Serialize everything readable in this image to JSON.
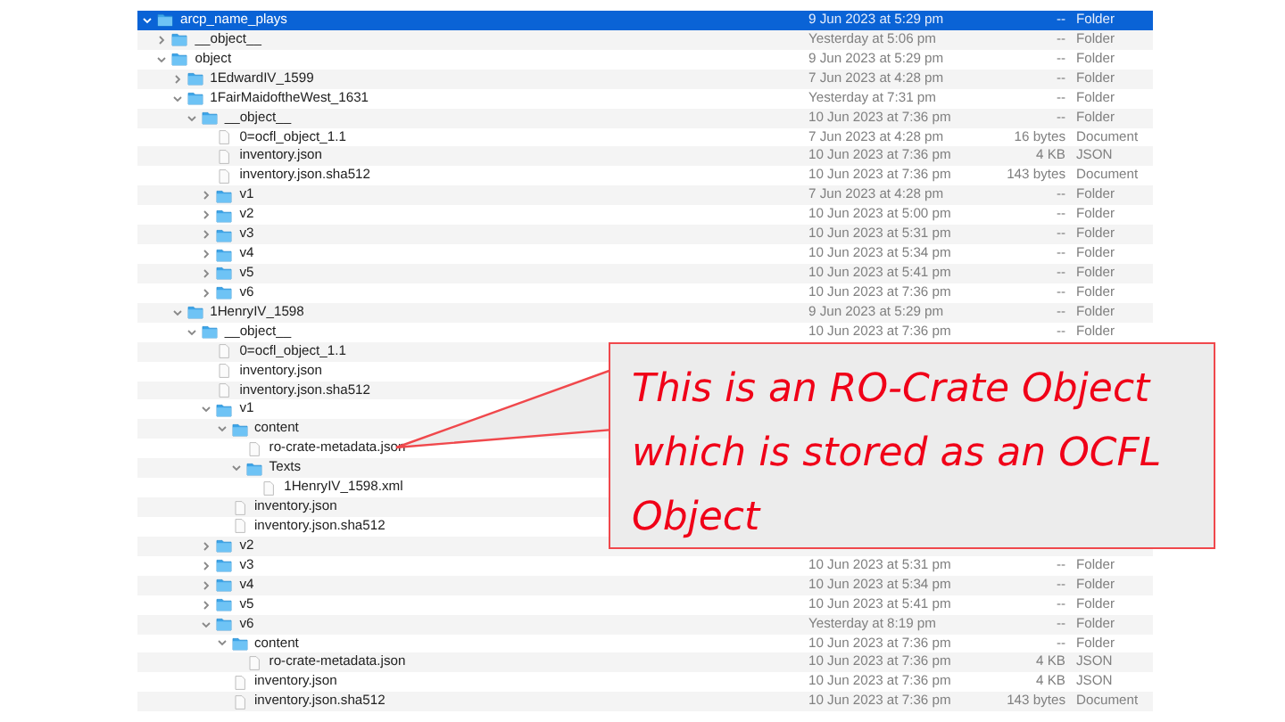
{
  "tree": [
    {
      "name": "arcp_name_plays",
      "kind": "folder",
      "expanded": true,
      "selected": true,
      "modified": "9 Jun 2023 at 5:29 pm",
      "file_size": "--",
      "file_kind": "Folder",
      "children": [
        {
          "name": "__object__",
          "kind": "folder",
          "expanded": false,
          "selected": false,
          "modified": "Yesterday at 5:06 pm",
          "file_size": "--",
          "file_kind": "Folder"
        },
        {
          "name": "object",
          "kind": "folder",
          "expanded": true,
          "selected": false,
          "modified": "9 Jun 2023 at 5:29 pm",
          "file_size": "--",
          "file_kind": "Folder",
          "children": [
            {
              "name": "1EdwardIV_1599",
              "kind": "folder",
              "expanded": false,
              "selected": false,
              "modified": "7 Jun 2023 at 4:28 pm",
              "file_size": "--",
              "file_kind": "Folder"
            },
            {
              "name": "1FairMaidoftheWest_1631",
              "kind": "folder",
              "expanded": true,
              "selected": false,
              "modified": "Yesterday at 7:31 pm",
              "file_size": "--",
              "file_kind": "Folder",
              "children": [
                {
                  "name": "__object__",
                  "kind": "folder",
                  "expanded": true,
                  "selected": false,
                  "modified": "10 Jun 2023 at 7:36 pm",
                  "file_size": "--",
                  "file_kind": "Folder",
                  "children": [
                    {
                      "name": "0=ocfl_object_1.1",
                      "kind": "file",
                      "selected": false,
                      "modified": "7 Jun 2023 at 4:28 pm",
                      "file_size": "16 bytes",
                      "file_kind": "Document"
                    },
                    {
                      "name": "inventory.json",
                      "kind": "file",
                      "selected": false,
                      "modified": "10 Jun 2023 at 7:36 pm",
                      "file_size": "4 KB",
                      "file_kind": "JSON"
                    },
                    {
                      "name": "inventory.json.sha512",
                      "kind": "file",
                      "selected": false,
                      "modified": "10 Jun 2023 at 7:36 pm",
                      "file_size": "143 bytes",
                      "file_kind": "Document"
                    },
                    {
                      "name": "v1",
                      "kind": "folder",
                      "expanded": false,
                      "selected": false,
                      "modified": "7 Jun 2023 at 4:28 pm",
                      "file_size": "--",
                      "file_kind": "Folder"
                    },
                    {
                      "name": "v2",
                      "kind": "folder",
                      "expanded": false,
                      "selected": false,
                      "modified": "10 Jun 2023 at 5:00 pm",
                      "file_size": "--",
                      "file_kind": "Folder"
                    },
                    {
                      "name": "v3",
                      "kind": "folder",
                      "expanded": false,
                      "selected": false,
                      "modified": "10 Jun 2023 at 5:31 pm",
                      "file_size": "--",
                      "file_kind": "Folder"
                    },
                    {
                      "name": "v4",
                      "kind": "folder",
                      "expanded": false,
                      "selected": false,
                      "modified": "10 Jun 2023 at 5:34 pm",
                      "file_size": "--",
                      "file_kind": "Folder"
                    },
                    {
                      "name": "v5",
                      "kind": "folder",
                      "expanded": false,
                      "selected": false,
                      "modified": "10 Jun 2023 at 5:41 pm",
                      "file_size": "--",
                      "file_kind": "Folder"
                    },
                    {
                      "name": "v6",
                      "kind": "folder",
                      "expanded": false,
                      "selected": false,
                      "modified": "10 Jun 2023 at 7:36 pm",
                      "file_size": "--",
                      "file_kind": "Folder"
                    }
                  ]
                }
              ]
            },
            {
              "name": "1HenryIV_1598",
              "kind": "folder",
              "expanded": true,
              "selected": false,
              "modified": "9 Jun 2023 at 5:29 pm",
              "file_size": "--",
              "file_kind": "Folder",
              "children": [
                {
                  "name": "__object__",
                  "kind": "folder",
                  "expanded": true,
                  "selected": false,
                  "modified": "10 Jun 2023 at 7:36 pm",
                  "file_size": "--",
                  "file_kind": "Folder",
                  "children": [
                    {
                      "name": "0=ocfl_object_1.1",
                      "kind": "file",
                      "selected": false
                    },
                    {
                      "name": "inventory.json",
                      "kind": "file",
                      "selected": false
                    },
                    {
                      "name": "inventory.json.sha512",
                      "kind": "file",
                      "selected": false
                    },
                    {
                      "name": "v1",
                      "kind": "folder",
                      "expanded": true,
                      "selected": false,
                      "children": [
                        {
                          "name": "content",
                          "kind": "folder",
                          "expanded": true,
                          "selected": false,
                          "children": [
                            {
                              "name": "ro-crate-metadata.json",
                              "kind": "file",
                              "selected": false
                            },
                            {
                              "name": "Texts",
                              "kind": "folder",
                              "expanded": true,
                              "selected": false,
                              "children": [
                                {
                                  "name": "1HenryIV_1598.xml",
                                  "kind": "file",
                                  "selected": false
                                }
                              ]
                            }
                          ]
                        },
                        {
                          "name": "inventory.json",
                          "kind": "file",
                          "selected": false
                        },
                        {
                          "name": "inventory.json.sha512",
                          "kind": "file",
                          "selected": false
                        }
                      ]
                    },
                    {
                      "name": "v2",
                      "kind": "folder",
                      "expanded": false,
                      "selected": false
                    },
                    {
                      "name": "v3",
                      "kind": "folder",
                      "expanded": false,
                      "selected": false,
                      "modified": "10 Jun 2023 at 5:31 pm",
                      "file_size": "--",
                      "file_kind": "Folder"
                    },
                    {
                      "name": "v4",
                      "kind": "folder",
                      "expanded": false,
                      "selected": false,
                      "modified": "10 Jun 2023 at 5:34 pm",
                      "file_size": "--",
                      "file_kind": "Folder"
                    },
                    {
                      "name": "v5",
                      "kind": "folder",
                      "expanded": false,
                      "selected": false,
                      "modified": "10 Jun 2023 at 5:41 pm",
                      "file_size": "--",
                      "file_kind": "Folder"
                    },
                    {
                      "name": "v6",
                      "kind": "folder",
                      "expanded": true,
                      "selected": false,
                      "modified": "Yesterday at 8:19 pm",
                      "file_size": "--",
                      "file_kind": "Folder",
                      "children": [
                        {
                          "name": "content",
                          "kind": "folder",
                          "expanded": true,
                          "selected": false,
                          "modified": "10 Jun 2023 at 7:36 pm",
                          "file_size": "--",
                          "file_kind": "Folder",
                          "children": [
                            {
                              "name": "ro-crate-metadata.json",
                              "kind": "file",
                              "selected": false,
                              "modified": "10 Jun 2023 at 7:36 pm",
                              "file_size": "4 KB",
                              "file_kind": "JSON"
                            }
                          ]
                        },
                        {
                          "name": "inventory.json",
                          "kind": "file",
                          "selected": false,
                          "modified": "10 Jun 2023 at 7:36 pm",
                          "file_size": "4 KB",
                          "file_kind": "JSON"
                        },
                        {
                          "name": "inventory.json.sha512",
                          "kind": "file",
                          "selected": false,
                          "modified": "10 Jun 2023 at 7:36 pm",
                          "file_size": "143 bytes",
                          "file_kind": "Document"
                        }
                      ]
                    }
                  ]
                }
              ]
            }
          ]
        }
      ]
    }
  ],
  "callout": {
    "text": "This is an RO-Crate Object which is stored as an OCFL Object"
  }
}
